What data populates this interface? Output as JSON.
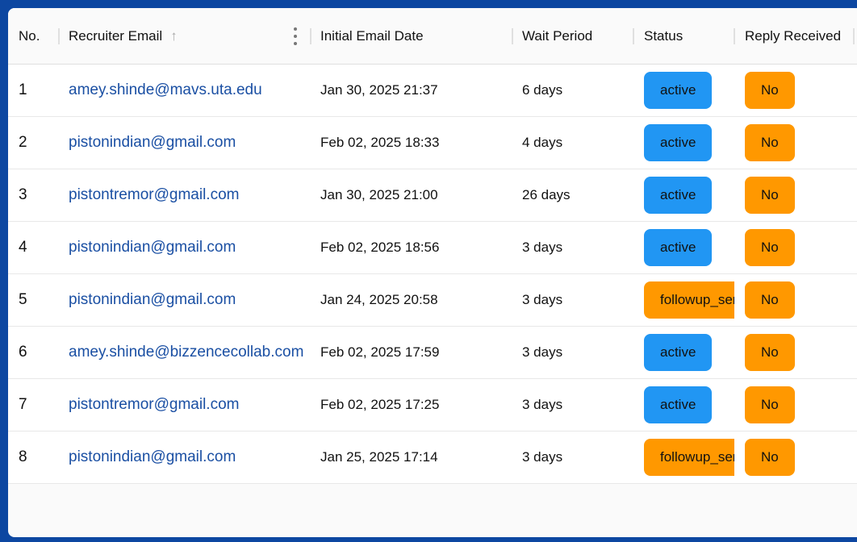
{
  "colors": {
    "frame": "#0d47a1",
    "link": "#1a4fa3",
    "active": "#2196f3",
    "warning": "#ff9800"
  },
  "header": {
    "no": "No.",
    "email": "Recruiter Email",
    "date": "Initial Email Date",
    "wait": "Wait Period",
    "status": "Status",
    "reply": "Reply Received"
  },
  "rows": [
    {
      "no": "1",
      "email": "amey.shinde@mavs.uta.edu",
      "date": "Jan 30, 2025 21:37",
      "wait": "6 days",
      "status": "active",
      "reply": "No"
    },
    {
      "no": "2",
      "email": "pistonindian@gmail.com",
      "date": "Feb 02, 2025 18:33",
      "wait": "4 days",
      "status": "active",
      "reply": "No"
    },
    {
      "no": "3",
      "email": "pistontremor@gmail.com",
      "date": "Jan 30, 2025 21:00",
      "wait": "26 days",
      "status": "active",
      "reply": "No"
    },
    {
      "no": "4",
      "email": "pistonindian@gmail.com",
      "date": "Feb 02, 2025 18:56",
      "wait": "3 days",
      "status": "active",
      "reply": "No"
    },
    {
      "no": "5",
      "email": "pistonindian@gmail.com",
      "date": "Jan 24, 2025 20:58",
      "wait": "3 days",
      "status": "followup_sent",
      "reply": "No"
    },
    {
      "no": "6",
      "email": "amey.shinde@bizzencecollab.com",
      "date": "Feb 02, 2025 17:59",
      "wait": "3 days",
      "status": "active",
      "reply": "No"
    },
    {
      "no": "7",
      "email": "pistontremor@gmail.com",
      "date": "Feb 02, 2025 17:25",
      "wait": "3 days",
      "status": "active",
      "reply": "No"
    },
    {
      "no": "8",
      "email": "pistonindian@gmail.com",
      "date": "Jan 25, 2025 17:14",
      "wait": "3 days",
      "status": "followup_sent",
      "reply": "No"
    }
  ]
}
